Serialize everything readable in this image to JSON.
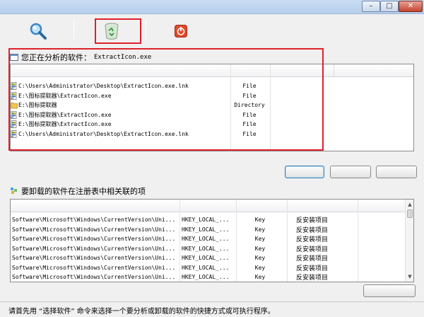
{
  "window": {
    "minimize_glyph": "–",
    "maximize_glyph": "□",
    "close_glyph": "✕"
  },
  "toolbar": {
    "analyze_icon": "magnifier-icon",
    "uninstall_icon": "recycle-bin-icon",
    "stop_icon": "power-icon"
  },
  "analysis": {
    "label": "您正在分析的软件：",
    "file": "ExtractIcon.exe",
    "rows": [
      {
        "icon": "shortcut-icon",
        "path": "C:\\Users\\Administrator\\Desktop\\ExtractIcon.exe.lnk",
        "type": "File"
      },
      {
        "icon": "shortcut-icon",
        "path": "E:\\图标提取器\\ExtractIcon.exe",
        "type": "File"
      },
      {
        "icon": "folder-icon",
        "path": "E:\\图标提取器",
        "type": "Directory"
      },
      {
        "icon": "shortcut-icon",
        "path": "E:\\图标提取器\\ExtractIcon.exe",
        "type": "File"
      },
      {
        "icon": "shortcut-icon",
        "path": "E:\\图标提取器\\ExtractIcon.exe",
        "type": "File"
      },
      {
        "icon": "shortcut-icon",
        "path": "C:\\Users\\Administrator\\Desktop\\ExtractIcon.exe.lnk",
        "type": "File"
      }
    ]
  },
  "registry": {
    "label": "要卸载的软件在注册表中相关联的项",
    "rows": [
      {
        "name": "Software\\Microsoft\\Windows\\CurrentVersion\\Uni...",
        "root": "HKEY_LOCAL_...",
        "kind": "Key",
        "desc": "反安装项目"
      },
      {
        "name": "Software\\Microsoft\\Windows\\CurrentVersion\\Uni...",
        "root": "HKEY_LOCAL_...",
        "kind": "Key",
        "desc": "反安装项目"
      },
      {
        "name": "Software\\Microsoft\\Windows\\CurrentVersion\\Uni...",
        "root": "HKEY_LOCAL_...",
        "kind": "Key",
        "desc": "反安装项目"
      },
      {
        "name": "Software\\Microsoft\\Windows\\CurrentVersion\\Uni...",
        "root": "HKEY_LOCAL_...",
        "kind": "Key",
        "desc": "反安装项目"
      },
      {
        "name": "Software\\Microsoft\\Windows\\CurrentVersion\\Uni...",
        "root": "HKEY_LOCAL_...",
        "kind": "Key",
        "desc": "反安装项目"
      },
      {
        "name": "Software\\Microsoft\\Windows\\CurrentVersion\\Uni...",
        "root": "HKEY_LOCAL_...",
        "kind": "Key",
        "desc": "反安装项目"
      },
      {
        "name": "Software\\Microsoft\\Windows\\CurrentVersion\\Uni...",
        "root": "HKEY_LOCAL_...",
        "kind": "Key",
        "desc": "反安装项目"
      }
    ]
  },
  "status": {
    "text": "请首先用 “选择软件” 命令来选择一个要分析或卸载的软件的快捷方式或可执行程序。"
  },
  "colors": {
    "highlight": "#e0202c",
    "accent": "#3c7fb1"
  }
}
